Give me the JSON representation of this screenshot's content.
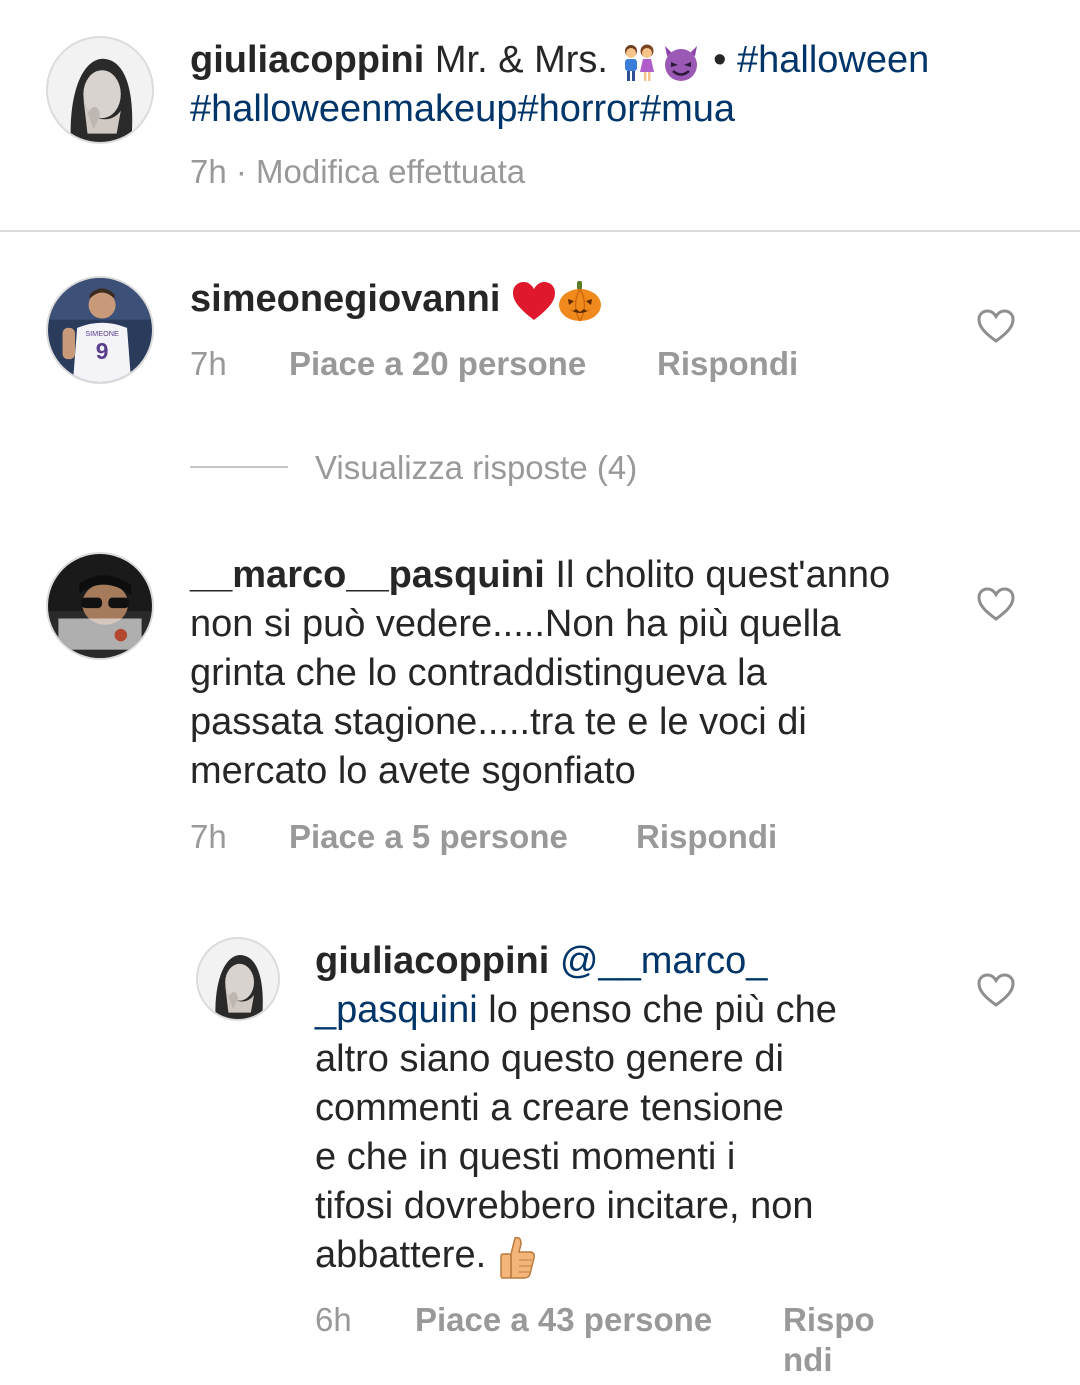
{
  "post": {
    "username": "giuliacoppini",
    "caption_text": "Mr. & Mrs.",
    "caption_separator": "•",
    "hashtag_1": "#halloween",
    "hashtags_line2": "#halloweenmakeup#horror#mua",
    "time": "7h",
    "edited_label": "· Modifica effettuata"
  },
  "comments": [
    {
      "username": "simeonegiovanni",
      "time": "7h",
      "likes": "Piace a 20 persone",
      "reply": "Rispondi",
      "view_replies": "Visualizza risposte (4)"
    },
    {
      "username": "__marco__pasquini",
      "lines": [
        "Il cholito quest'anno",
        "non si può vedere.....Non ha più quella",
        "grinta che lo contraddistingueva la",
        "passata stagione.....tra te e le voci di",
        "mercato lo avete sgonfiato"
      ],
      "time": "7h",
      "likes": "Piace a 5 persone",
      "reply": "Rispondi"
    }
  ],
  "reply": {
    "username": "giuliacoppini",
    "mention_part1": "@__marco_",
    "mention_part2": "_pasquini",
    "lines": [
      "lo penso che più che",
      "altro siano questo genere di",
      "commenti a creare tensione",
      "e che in questi momenti i",
      "tifosi dovrebbero incitare, non",
      "abbattere."
    ],
    "time": "6h",
    "likes": "Piace a 43 persone",
    "reply_label_part1": "Rispo",
    "reply_label_part2": "ndi"
  },
  "icons": {
    "couple": "couple-emoji-icon",
    "devil": "devil-emoji-icon",
    "heart_red": "red-heart-emoji-icon",
    "pumpkin": "pumpkin-emoji-icon",
    "thumbs": "thumbs-up-emoji-icon",
    "like": "heart-outline-icon"
  },
  "colors": {
    "link": "#003569",
    "meta": "#999999",
    "text": "#262626"
  }
}
